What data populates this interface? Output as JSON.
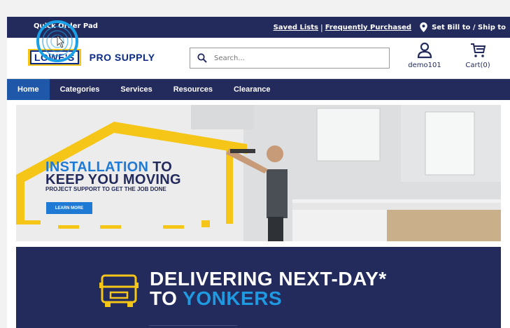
{
  "utility_bar": {
    "quick_order": "Quick Order Pad",
    "saved_lists": "Saved Lists",
    "separator": "|",
    "frequently_purchased": "Frequently Purchased",
    "ship_to": "Set Bill to / Ship to"
  },
  "header": {
    "logo_mark": "LOWE'S",
    "logo_text": "PRO SUPPLY",
    "search_placeholder": "Search...",
    "account_label": "demo101",
    "cart_label": "Cart(0)"
  },
  "nav": {
    "items": [
      "Home",
      "Categories",
      "Services",
      "Resources",
      "Clearance"
    ],
    "active": "Home"
  },
  "hero": {
    "headline_blue": "INSTALLATION",
    "headline_to": " TO",
    "headline_line2": "KEEP YOU MOVING",
    "subheading": "PROJECT SUPPORT TO GET THE JOB DONE",
    "cta": "LEARN MORE"
  },
  "delivery_banner": {
    "line1": "DELIVERING NEXT-DAY*",
    "line2_to": "TO ",
    "line2_city": "YONKERS"
  },
  "colors": {
    "navy": "#232a5c",
    "active_tab": "#1f58a8",
    "accent_blue": "#1f7ad6",
    "yellow": "#f5c518"
  }
}
